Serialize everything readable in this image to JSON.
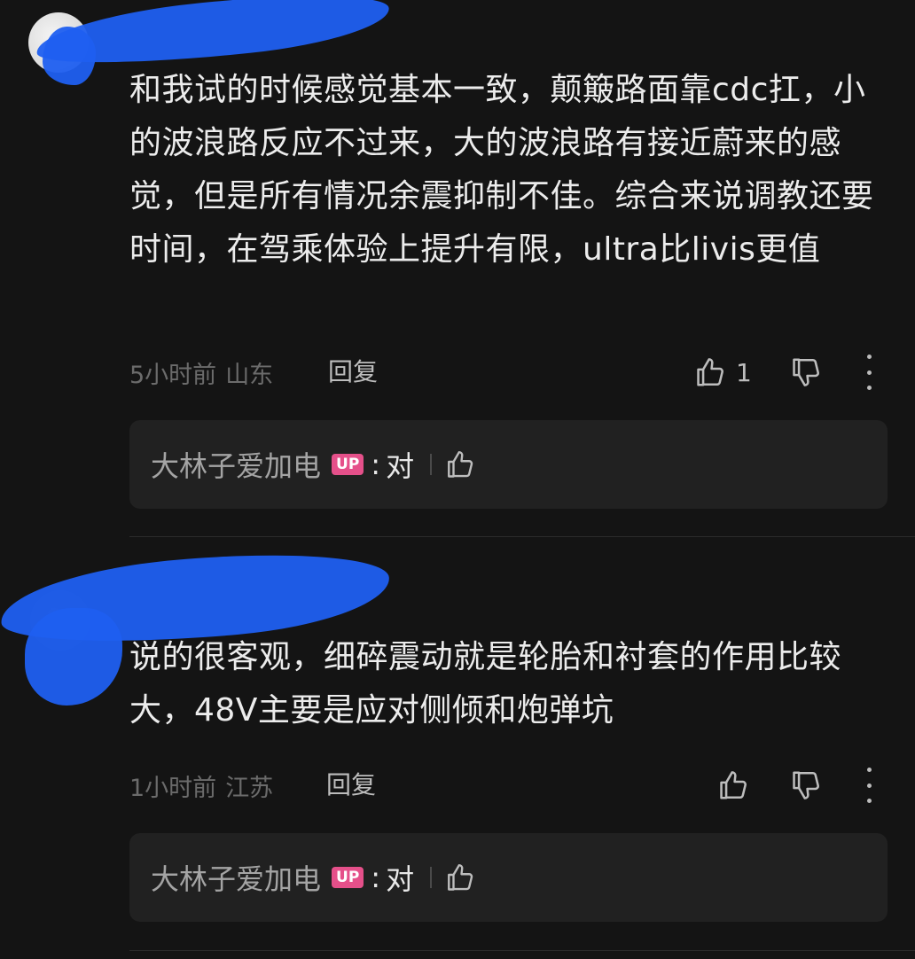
{
  "comments": [
    {
      "text": "和我试的时候感觉基本一致，颠簸路面靠cdc扛，小的波浪路反应不过来，大的波浪路有接近蔚来的感觉，但是所有情况余震抑制不佳。综合来说调教还要时间，在驾乘体验上提升有限，ultra比livis更值",
      "time": "5小时前",
      "location": "山东",
      "reply_label": "回复",
      "like_count": "1",
      "replies": [
        {
          "author": "大林子爱加电",
          "badge": "UP",
          "colon": ":",
          "content": "对"
        }
      ]
    },
    {
      "text": "说的很客观，细碎震动就是轮胎和衬套的作用比较大，48V主要是应对侧倾和炮弹坑",
      "time": "1小时前",
      "location": "江苏",
      "reply_label": "回复",
      "like_count": "",
      "replies": [
        {
          "author": "大林子爱加电",
          "badge": "UP",
          "colon": ":",
          "content": "对"
        }
      ]
    }
  ],
  "icons": {
    "like": "thumbs-up-icon",
    "dislike": "thumbs-down-icon",
    "more": "more-vertical-icon"
  },
  "colors": {
    "background": "#141414",
    "reply_box": "#212121",
    "up_badge": "#e5508a",
    "redaction_scribble": "#1f5ff0"
  }
}
